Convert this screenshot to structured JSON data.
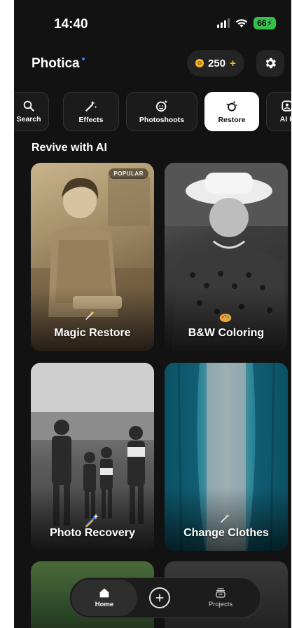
{
  "status_bar": {
    "time": "14:40",
    "battery": "66"
  },
  "header": {
    "app_name": "Photica",
    "coins": "250",
    "coins_plus": "+"
  },
  "tabs": [
    {
      "label": "Search",
      "icon": "search-icon"
    },
    {
      "label": "Effects",
      "icon": "magic-wand-icon"
    },
    {
      "label": "Photoshoots",
      "icon": "camera-face-icon"
    },
    {
      "label": "Restore",
      "icon": "restore-brush-icon",
      "active": true
    },
    {
      "label": "AI P",
      "icon": "ai-portrait-icon"
    }
  ],
  "section": {
    "title": "Revive with AI"
  },
  "cards": [
    {
      "label": "Magic Restore",
      "badge": "POPULAR"
    },
    {
      "label": "B&W Coloring"
    },
    {
      "label": "Photo Recovery"
    },
    {
      "label": "Change Clothes"
    }
  ],
  "bottom_nav": {
    "home": "Home",
    "projects": "Projects"
  },
  "colors": {
    "accent_coin": "#f5b829",
    "battery": "#33c14a",
    "background": "#121212"
  }
}
